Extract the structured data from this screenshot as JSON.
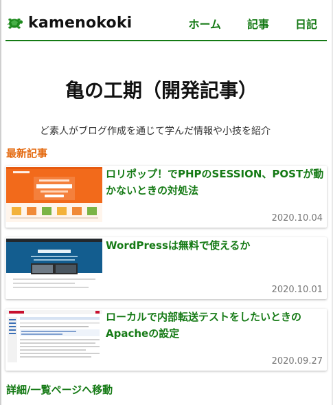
{
  "header": {
    "site_name": "kamenokoki",
    "logo_icon": "turtle-icon",
    "nav": [
      {
        "label": "ホーム"
      },
      {
        "label": "記事"
      },
      {
        "label": "日記"
      }
    ]
  },
  "main": {
    "title": "亀の工期（開発記事）",
    "subtitle": "ど素人がブログ作成を通じて学んだ情報や小技を紹介",
    "section_heading": "最新記事",
    "articles": [
      {
        "title": "ロリポップ！でPHPのSESSION、POSTが動かないときの対処法",
        "date": "2020.10.04"
      },
      {
        "title": "WordPressは無料で使えるか",
        "date": "2020.10.01"
      },
      {
        "title": "ローカルで内部転送テストをしたいときのApacheの設定",
        "date": "2020.09.27"
      }
    ],
    "more_link": "詳細/一覧ページへ移動"
  },
  "colors": {
    "accent_green": "#157a15",
    "heading_orange": "#e46a10"
  }
}
